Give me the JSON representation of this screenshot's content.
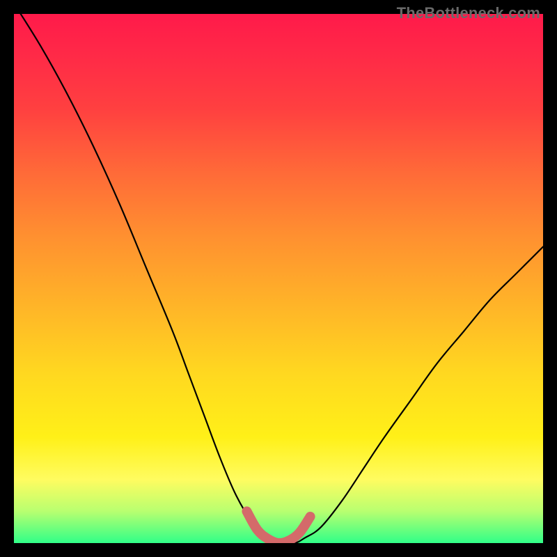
{
  "watermark": "TheBottleneck.com",
  "chart_data": {
    "type": "line",
    "title": "",
    "xlabel": "",
    "ylabel": "",
    "xlim": [
      0,
      100
    ],
    "ylim": [
      0,
      100
    ],
    "series": [
      {
        "name": "bottleneck-curve",
        "x": [
          0,
          5,
          10,
          15,
          20,
          25,
          30,
          33,
          36,
          39,
          42,
          45,
          48,
          50,
          53,
          55,
          58,
          62,
          66,
          70,
          75,
          80,
          85,
          90,
          95,
          100
        ],
        "y": [
          102,
          94,
          85,
          75,
          64,
          52,
          40,
          32,
          24,
          16,
          9,
          4,
          1,
          0,
          0,
          1,
          3,
          8,
          14,
          20,
          27,
          34,
          40,
          46,
          51,
          56
        ]
      },
      {
        "name": "optimal-band",
        "x": [
          44,
          46,
          48,
          50,
          52,
          54,
          56
        ],
        "y": [
          6,
          2.5,
          0.8,
          0,
          0.5,
          2,
          5
        ]
      }
    ]
  },
  "colors": {
    "curve": "#000000",
    "band": "#d46a6a"
  }
}
